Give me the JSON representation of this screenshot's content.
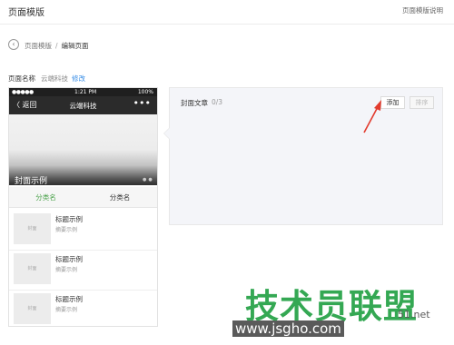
{
  "header": {
    "title": "页面模版",
    "help_link": "页面模版说明"
  },
  "breadcrumb": {
    "parent": "页面模版",
    "separator": "/",
    "current": "编辑页面"
  },
  "page_name": {
    "label": "页面名称",
    "value": "云端科技",
    "edit": "修改"
  },
  "phone": {
    "status_signal": "●●●●● ",
    "status_time": "1:21 PM",
    "status_battery": "100%",
    "nav_back": "〈 返回",
    "nav_title": "云端科技",
    "nav_more": "•••",
    "cover_text": "封面示例",
    "cover_dots": "●●",
    "categories": [
      "分类名",
      "分类名"
    ],
    "items": [
      {
        "thumb": "封面",
        "title": "标题示例",
        "summary": "摘要示例"
      },
      {
        "thumb": "封面",
        "title": "标题示例",
        "summary": "摘要示例"
      },
      {
        "thumb": "封面",
        "title": "标题示例",
        "summary": "摘要示例"
      }
    ]
  },
  "panel": {
    "label": "封面文章",
    "count": "0/3",
    "add_button": "添加",
    "sort_button": "排序"
  },
  "annotation": {
    "arrow_color": "#e23b2e"
  },
  "watermark": {
    "text": "技术员联盟",
    "url": "www.jsgho.com",
    "small": "51.net"
  },
  "colors": {
    "category_active": "#4aa24a",
    "link": "#3a8ee6",
    "watermark": "#34a853"
  }
}
